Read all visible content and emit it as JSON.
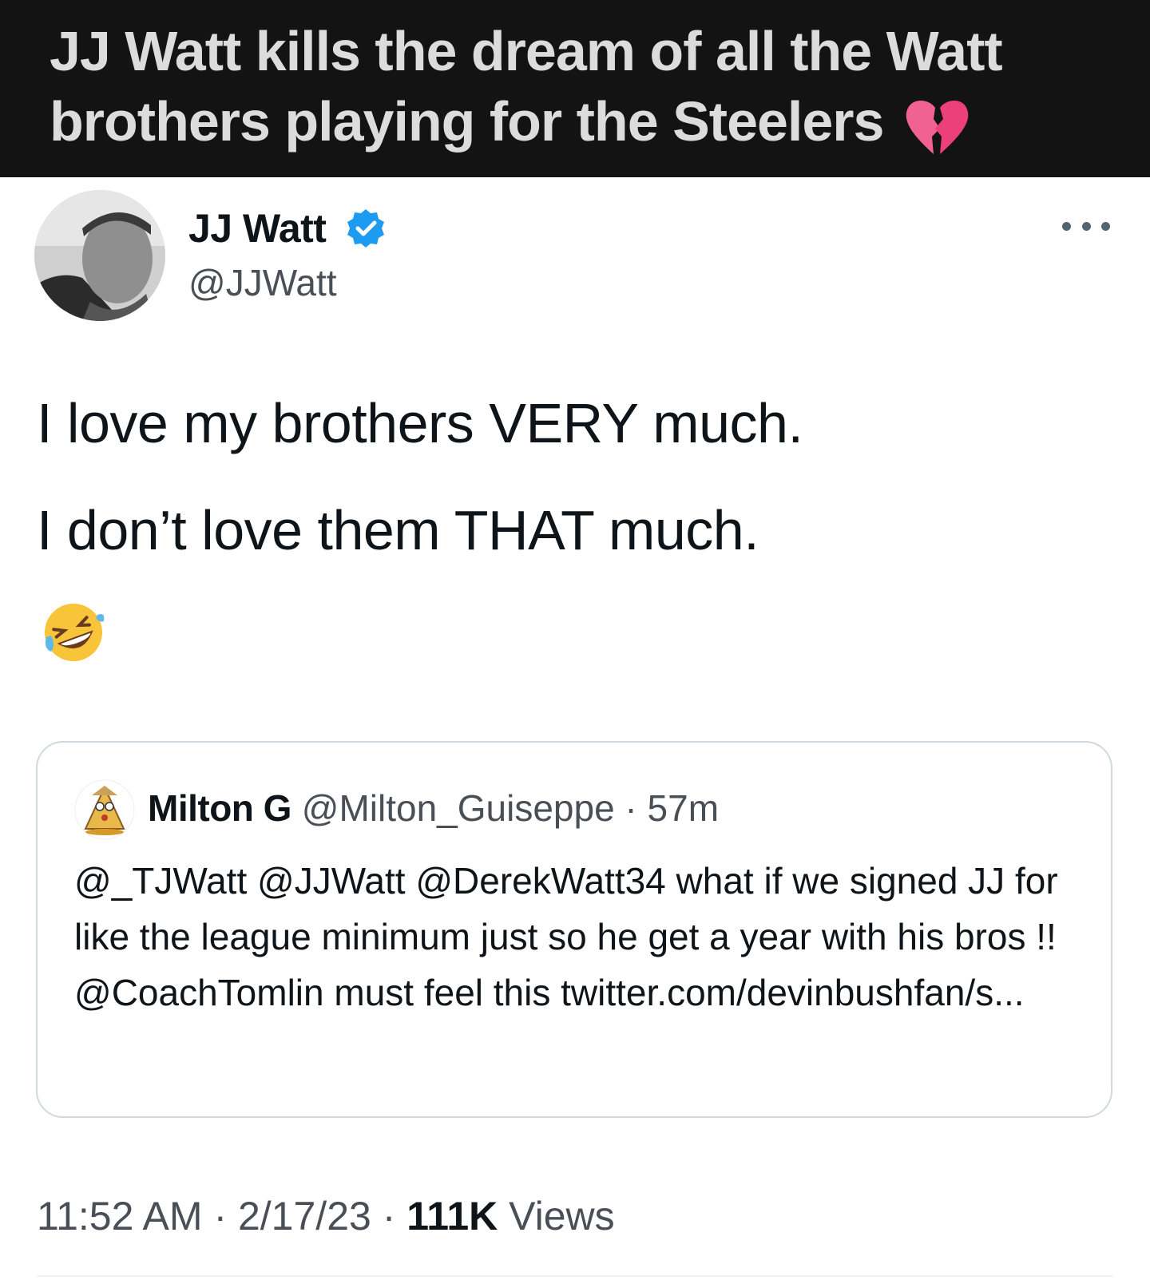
{
  "caption": {
    "text": "JJ Watt kills the dream of all the Watt brothers playing for the Steelers",
    "emoji": "💔"
  },
  "tweet": {
    "author_name": "JJ Watt",
    "author_handle": "@JJWatt",
    "verified": true,
    "lines": [
      "I love my brothers VERY much.",
      "I don’t love them THAT much."
    ],
    "emoji": "🤣",
    "time": "11:52 AM",
    "sep1": " · ",
    "date": "2/17/23",
    "sep2": " · ",
    "views_count": "111K",
    "views_label": " Views"
  },
  "quoted_tweet": {
    "author_name": "Milton G",
    "author_handle": "@Milton_Guiseppe",
    "separator": " · ",
    "age": "57m",
    "text": "@_TJWatt @JJWatt @DerekWatt34 what if we signed JJ for like the league minimum just so he get a year with his bros !! @CoachTomlin must feel this twitter.com/devinbushfan/s..."
  },
  "colors": {
    "banner_bg": "#131313",
    "banner_text": "#dcdcdc",
    "verified_blue": "#1d9bf0",
    "text_primary": "#0f1419",
    "text_secondary": "#4a4f55",
    "border": "#cfd9de"
  }
}
